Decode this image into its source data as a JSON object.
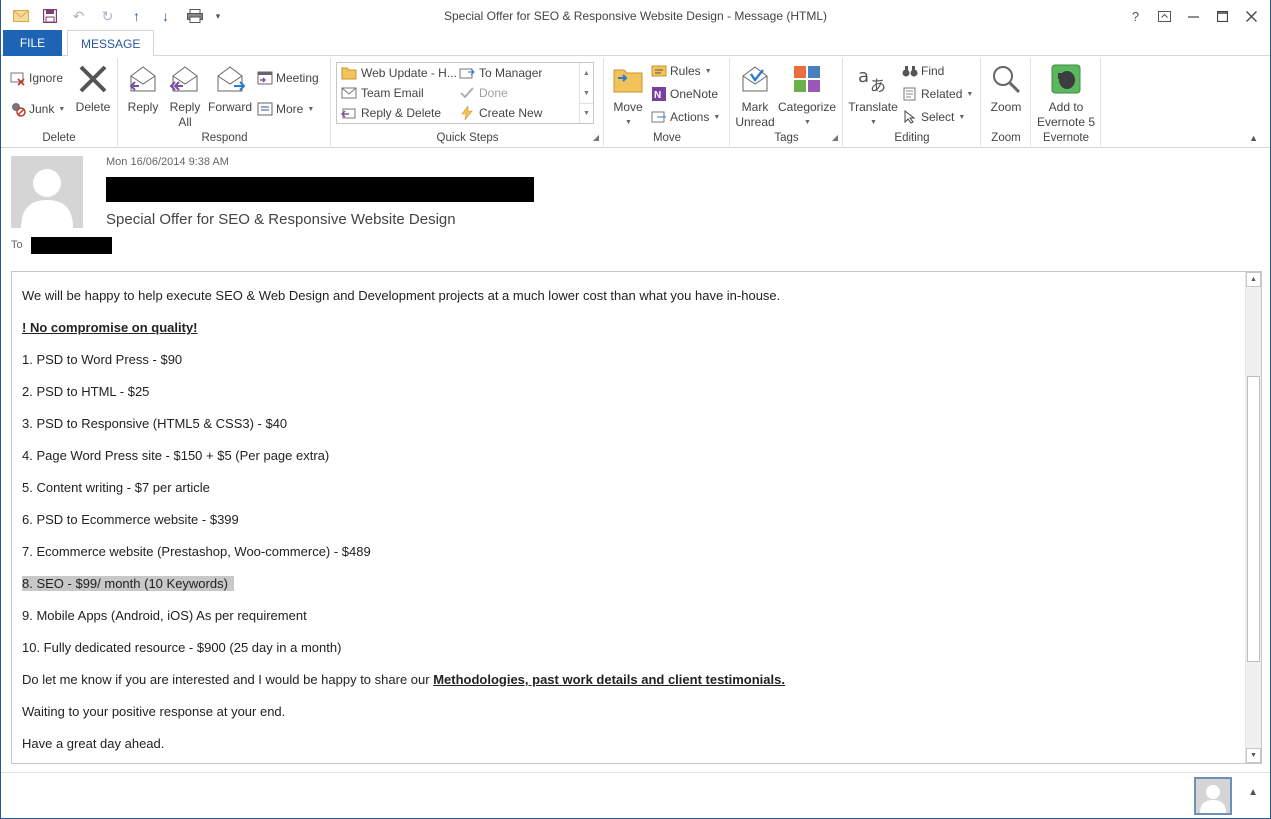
{
  "window": {
    "title": "Special Offer for SEO & Responsive Website Design - Message (HTML)",
    "help": "?",
    "accent": "#2b579a"
  },
  "tabs": [
    {
      "label": "FILE"
    },
    {
      "label": "MESSAGE"
    }
  ],
  "ribbon": {
    "delete": {
      "label": "Delete",
      "ignore": "Ignore",
      "junk": "Junk",
      "delete_btn": "Delete"
    },
    "respond": {
      "label": "Respond",
      "reply": "Reply",
      "reply_all_1": "Reply",
      "reply_all_2": "All",
      "forward": "Forward",
      "meeting": "Meeting",
      "more": "More"
    },
    "quick_steps": {
      "label": "Quick Steps",
      "items": [
        "Web Update - H...",
        "To Manager",
        "Team Email",
        "Done",
        "Reply & Delete",
        "Create New"
      ]
    },
    "move": {
      "label": "Move",
      "move_btn": "Move",
      "rules": "Rules",
      "onenote": "OneNote",
      "actions": "Actions"
    },
    "tags": {
      "label": "Tags",
      "mark_1": "Mark",
      "mark_2": "Unread",
      "categorize": "Categorize"
    },
    "editing": {
      "label": "Editing",
      "translate": "Translate",
      "find": "Find",
      "related": "Related",
      "select": "Select"
    },
    "zoom": {
      "label": "Zoom",
      "zoom_btn": "Zoom"
    },
    "evernote": {
      "label": "Evernote",
      "add_1": "Add to",
      "add_2": "Evernote 5"
    }
  },
  "header": {
    "date": "Mon 16/06/2014 9:38 AM",
    "subject": "Special Offer for SEO & Responsive Website Design",
    "to_label": "To"
  },
  "body": {
    "intro": "We will be happy to help execute SEO & Web Design and Development projects at a much lower cost than what you have in-house.",
    "quality": "! No compromise on quality!",
    "items": [
      "1.  PSD to Word Press - $90",
      "2.  PSD to HTML - $25",
      "3. PSD to Responsive (HTML5 & CSS3) - $40",
      "4. Page Word Press site - $150 + $5 (Per page extra)",
      "5. Content writing - $7 per article",
      "6. PSD to Ecommerce website - $399",
      "7. Ecommerce website (Prestashop, Woo-commerce) - $489",
      "8. SEO - $99/ month (10 Keywords)",
      "9.  Mobile Apps (Android, iOS) As per requirement",
      "10. Fully dedicated resource - $900 (25 day in a month)"
    ],
    "closing_prefix": "Do let me know if you are interested and I would be happy to share our ",
    "closing_link": "Methodologies, past work details and client testimonials.",
    "waiting": "Waiting to your positive response at your end.",
    "signoff": "Have a great day ahead."
  }
}
